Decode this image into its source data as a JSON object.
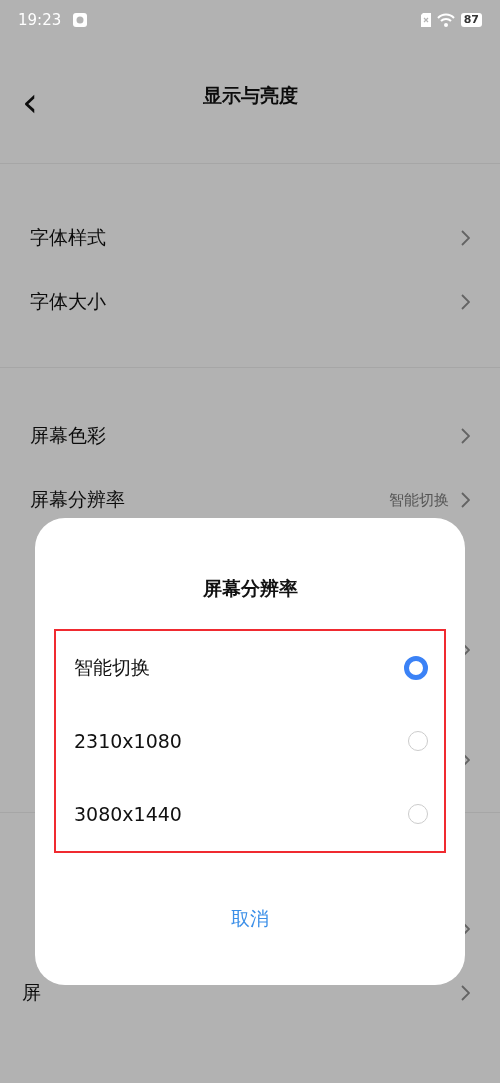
{
  "status_bar": {
    "time": "19:23",
    "battery": "87"
  },
  "header": {
    "back": "‹",
    "title": "显示与亮度"
  },
  "groups": [
    {
      "rows": [
        {
          "kind": "plain",
          "label": "字体样式"
        },
        {
          "kind": "plain",
          "label": "字体大小"
        }
      ]
    },
    {
      "rows": [
        {
          "kind": "plain",
          "label": "屏幕色彩"
        },
        {
          "kind": "plain",
          "label": "屏幕分辨率",
          "value": "智能切换"
        },
        {
          "kind": "tall"
        },
        {
          "kind": "tall"
        }
      ]
    },
    {
      "rows": [
        {
          "kind": "plain"
        },
        {
          "kind": "plain",
          "label": "屏"
        }
      ]
    }
  ],
  "dialog": {
    "title": "屏幕分辨率",
    "options": [
      {
        "label": "智能切换",
        "selected": true
      },
      {
        "label": "2310x1080",
        "selected": false
      },
      {
        "label": "3080x1440",
        "selected": false
      }
    ],
    "cancel": "取消"
  }
}
